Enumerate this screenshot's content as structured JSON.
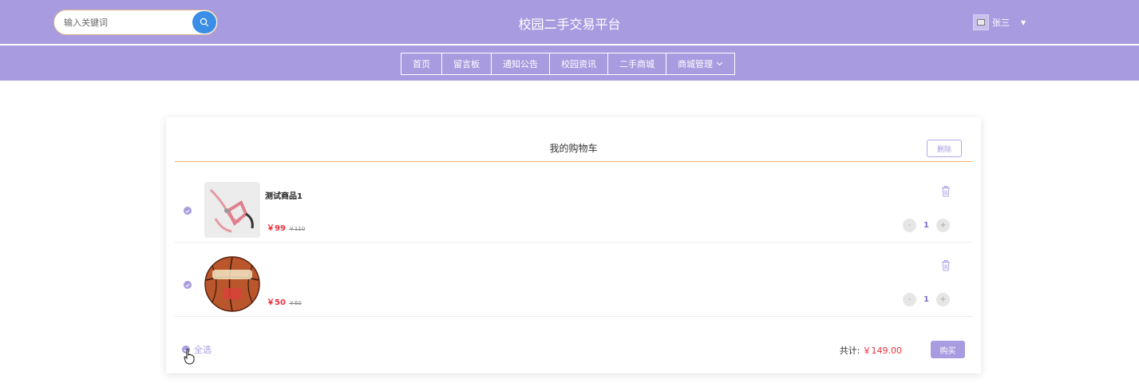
{
  "header": {
    "search_placeholder": "输入关键词",
    "site_title": "校园二手交易平台",
    "username": "张三",
    "icons": {
      "search": "search-icon",
      "avatar": "broken-image-icon",
      "caret": "caret-down-icon"
    }
  },
  "nav": {
    "items": [
      {
        "label": "首页"
      },
      {
        "label": "留言板"
      },
      {
        "label": "通知公告"
      },
      {
        "label": "校园资讯"
      },
      {
        "label": "二手商城"
      },
      {
        "label": "商城管理",
        "has_dropdown": true
      }
    ]
  },
  "cart": {
    "title": "我的购物车",
    "delete_label": "删除",
    "items": [
      {
        "name": "测试商品1",
        "price": "￥99",
        "original_price": "￥110",
        "quantity": "1",
        "minus": "-",
        "plus": "+",
        "checked": true,
        "image": "pink-leash"
      },
      {
        "name": "",
        "price": "￥50",
        "original_price": "￥60",
        "quantity": "1",
        "minus": "-",
        "plus": "+",
        "checked": true,
        "image": "spalding-basketball"
      }
    ],
    "select_all_label": "全选",
    "total_label": "共计:",
    "total_value": "￥149.00",
    "buy_label": "购买"
  },
  "colors": {
    "header_bg": "#a99be0",
    "accent": "#a99be0",
    "price": "#e8323c",
    "search_button": "#3a8ee6",
    "divider": "#f2b070"
  }
}
